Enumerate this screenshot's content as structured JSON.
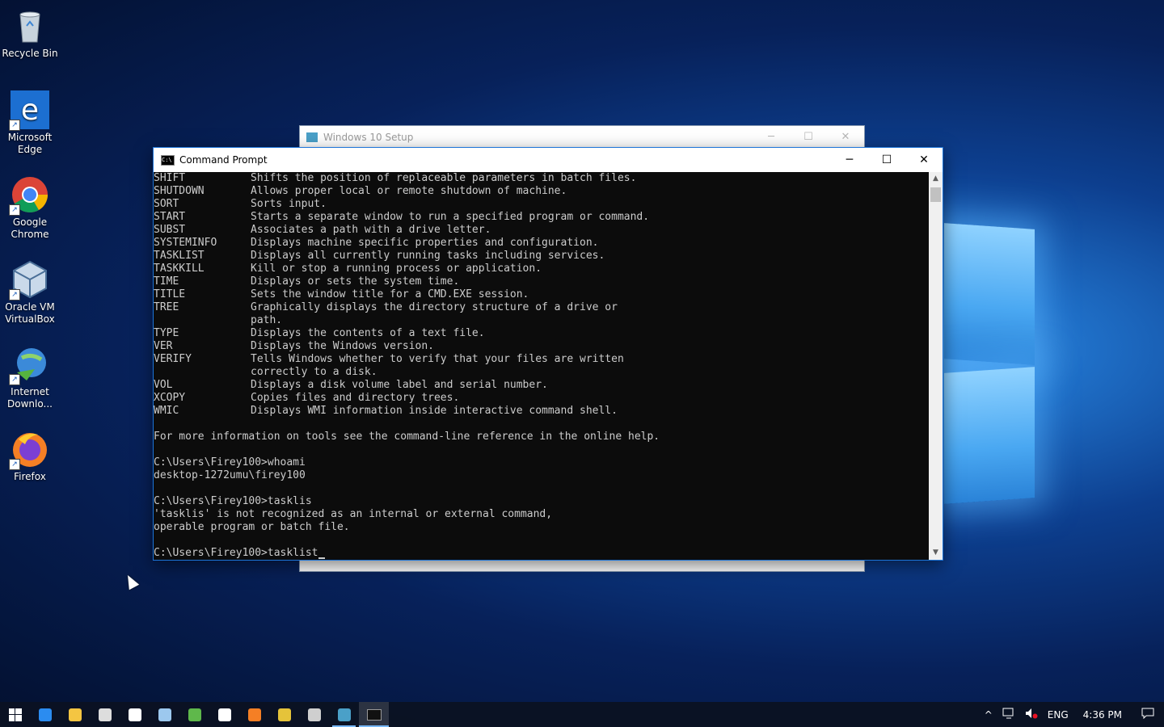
{
  "desktop": {
    "icons": [
      {
        "label": "Recycle Bin",
        "icon": "recycle-bin-icon"
      },
      {
        "label": "Microsoft Edge",
        "icon": "edge-icon"
      },
      {
        "label": "Google Chrome",
        "icon": "chrome-icon"
      },
      {
        "label": "Oracle VM VirtualBox",
        "icon": "virtualbox-icon"
      },
      {
        "label": "Internet Downlo...",
        "icon": "internet-download-manager-icon"
      },
      {
        "label": "Firefox",
        "icon": "firefox-icon"
      }
    ]
  },
  "setup_window": {
    "title": "Windows 10 Setup",
    "controls": {
      "minimize": "─",
      "maximize": "☐",
      "close": "✕"
    }
  },
  "cmd_window": {
    "title": "Command Prompt",
    "icon_text": "C:\\",
    "controls": {
      "minimize": "─",
      "maximize": "☐",
      "close": "✕"
    },
    "help_rows": [
      {
        "cmd": "SHIFT",
        "desc": "Shifts the position of replaceable parameters in batch files."
      },
      {
        "cmd": "SHUTDOWN",
        "desc": "Allows proper local or remote shutdown of machine."
      },
      {
        "cmd": "SORT",
        "desc": "Sorts input."
      },
      {
        "cmd": "START",
        "desc": "Starts a separate window to run a specified program or command."
      },
      {
        "cmd": "SUBST",
        "desc": "Associates a path with a drive letter."
      },
      {
        "cmd": "SYSTEMINFO",
        "desc": "Displays machine specific properties and configuration."
      },
      {
        "cmd": "TASKLIST",
        "desc": "Displays all currently running tasks including services."
      },
      {
        "cmd": "TASKKILL",
        "desc": "Kill or stop a running process or application."
      },
      {
        "cmd": "TIME",
        "desc": "Displays or sets the system time."
      },
      {
        "cmd": "TITLE",
        "desc": "Sets the window title for a CMD.EXE session."
      },
      {
        "cmd": "TREE",
        "desc": "Graphically displays the directory structure of a drive or"
      },
      {
        "cmd": "",
        "desc": "path."
      },
      {
        "cmd": "TYPE",
        "desc": "Displays the contents of a text file."
      },
      {
        "cmd": "VER",
        "desc": "Displays the Windows version."
      },
      {
        "cmd": "VERIFY",
        "desc": "Tells Windows whether to verify that your files are written"
      },
      {
        "cmd": "",
        "desc": "correctly to a disk."
      },
      {
        "cmd": "VOL",
        "desc": "Displays a disk volume label and serial number."
      },
      {
        "cmd": "XCOPY",
        "desc": "Copies files and directory trees."
      },
      {
        "cmd": "WMIC",
        "desc": "Displays WMI information inside interactive command shell."
      }
    ],
    "more_info": "For more information on tools see the command-line reference in the online help.",
    "prompt1": "C:\\Users\\Firey100>whoami",
    "output1": "desktop-1272umu\\firey100",
    "prompt2": "C:\\Users\\Firey100>tasklis",
    "error_line1": "'tasklis' is not recognized as an internal or external command,",
    "error_line2": "operable program or batch file.",
    "current_prompt": "C:\\Users\\Firey100>tasklist"
  },
  "taskbar": {
    "items": [
      {
        "icon": "start-windows-icon",
        "color": "#ffffff"
      },
      {
        "icon": "edge-icon",
        "color": "#2b8cf0"
      },
      {
        "icon": "file-explorer-icon",
        "color": "#f4c542"
      },
      {
        "icon": "store-icon",
        "color": "#dddddd"
      },
      {
        "icon": "mail-icon",
        "color": "#ffffff"
      },
      {
        "icon": "virtualbox-icon",
        "color": "#9cc8ee"
      },
      {
        "icon": "internet-download-manager-icon",
        "color": "#5fb84b"
      },
      {
        "icon": "solitaire-icon",
        "color": "#ffffff"
      },
      {
        "icon": "firefox-icon",
        "color": "#f57f25"
      },
      {
        "icon": "chrome-icon",
        "color": "#e5c33a"
      },
      {
        "icon": "window-app-icon",
        "color": "#cfcfcf"
      },
      {
        "icon": "windows-setup-icon",
        "color": "#4aa0c8"
      },
      {
        "icon": "command-prompt-icon",
        "color": "#333333"
      }
    ],
    "tray": {
      "chevron": "^",
      "network_icon": "network-icon",
      "volume_icon": "volume-muted-icon",
      "language": "ENG",
      "time": "4:36 PM",
      "notification_icon": "action-center-icon"
    }
  }
}
